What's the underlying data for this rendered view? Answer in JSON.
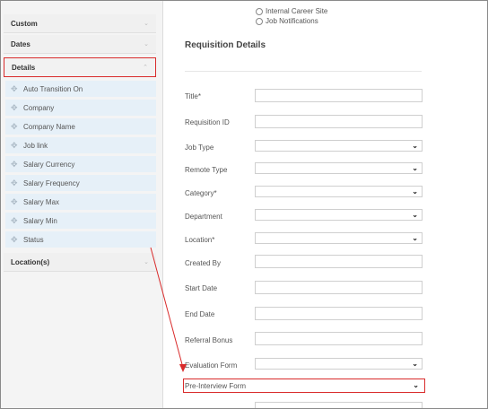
{
  "sidebar": {
    "sections": [
      {
        "label": "Custom"
      },
      {
        "label": "Dates"
      },
      {
        "label": "Details"
      }
    ],
    "details_items": [
      "Auto Transition On",
      "Company",
      "Company Name",
      "Job link",
      "Salary Currency",
      "Salary Frequency",
      "Salary Max",
      "Salary Min",
      "Status"
    ],
    "location_section": "Location(s)"
  },
  "main": {
    "checkbox_internal": "Internal Career Site",
    "checkbox_notify": "Job Notifications",
    "section_title": "Requisition Details",
    "fields": {
      "title": "Title*",
      "requisition_id": "Requisition ID",
      "job_type": "Job Type",
      "remote_type": "Remote Type",
      "category": "Category*",
      "department": "Department",
      "location": "Location*",
      "created_by": "Created By",
      "start_date": "Start Date",
      "end_date": "End Date",
      "referral_bonus": "Referral Bonus",
      "evaluation_form": "Evaluation Form",
      "pre_interview_form": "Pre-Interview Form"
    }
  },
  "colors": {
    "highlight": "#d92b2b",
    "item_bg": "#e6f0f8"
  },
  "icons": {
    "move": "move-icon",
    "chevron": "chevron-down-icon"
  }
}
